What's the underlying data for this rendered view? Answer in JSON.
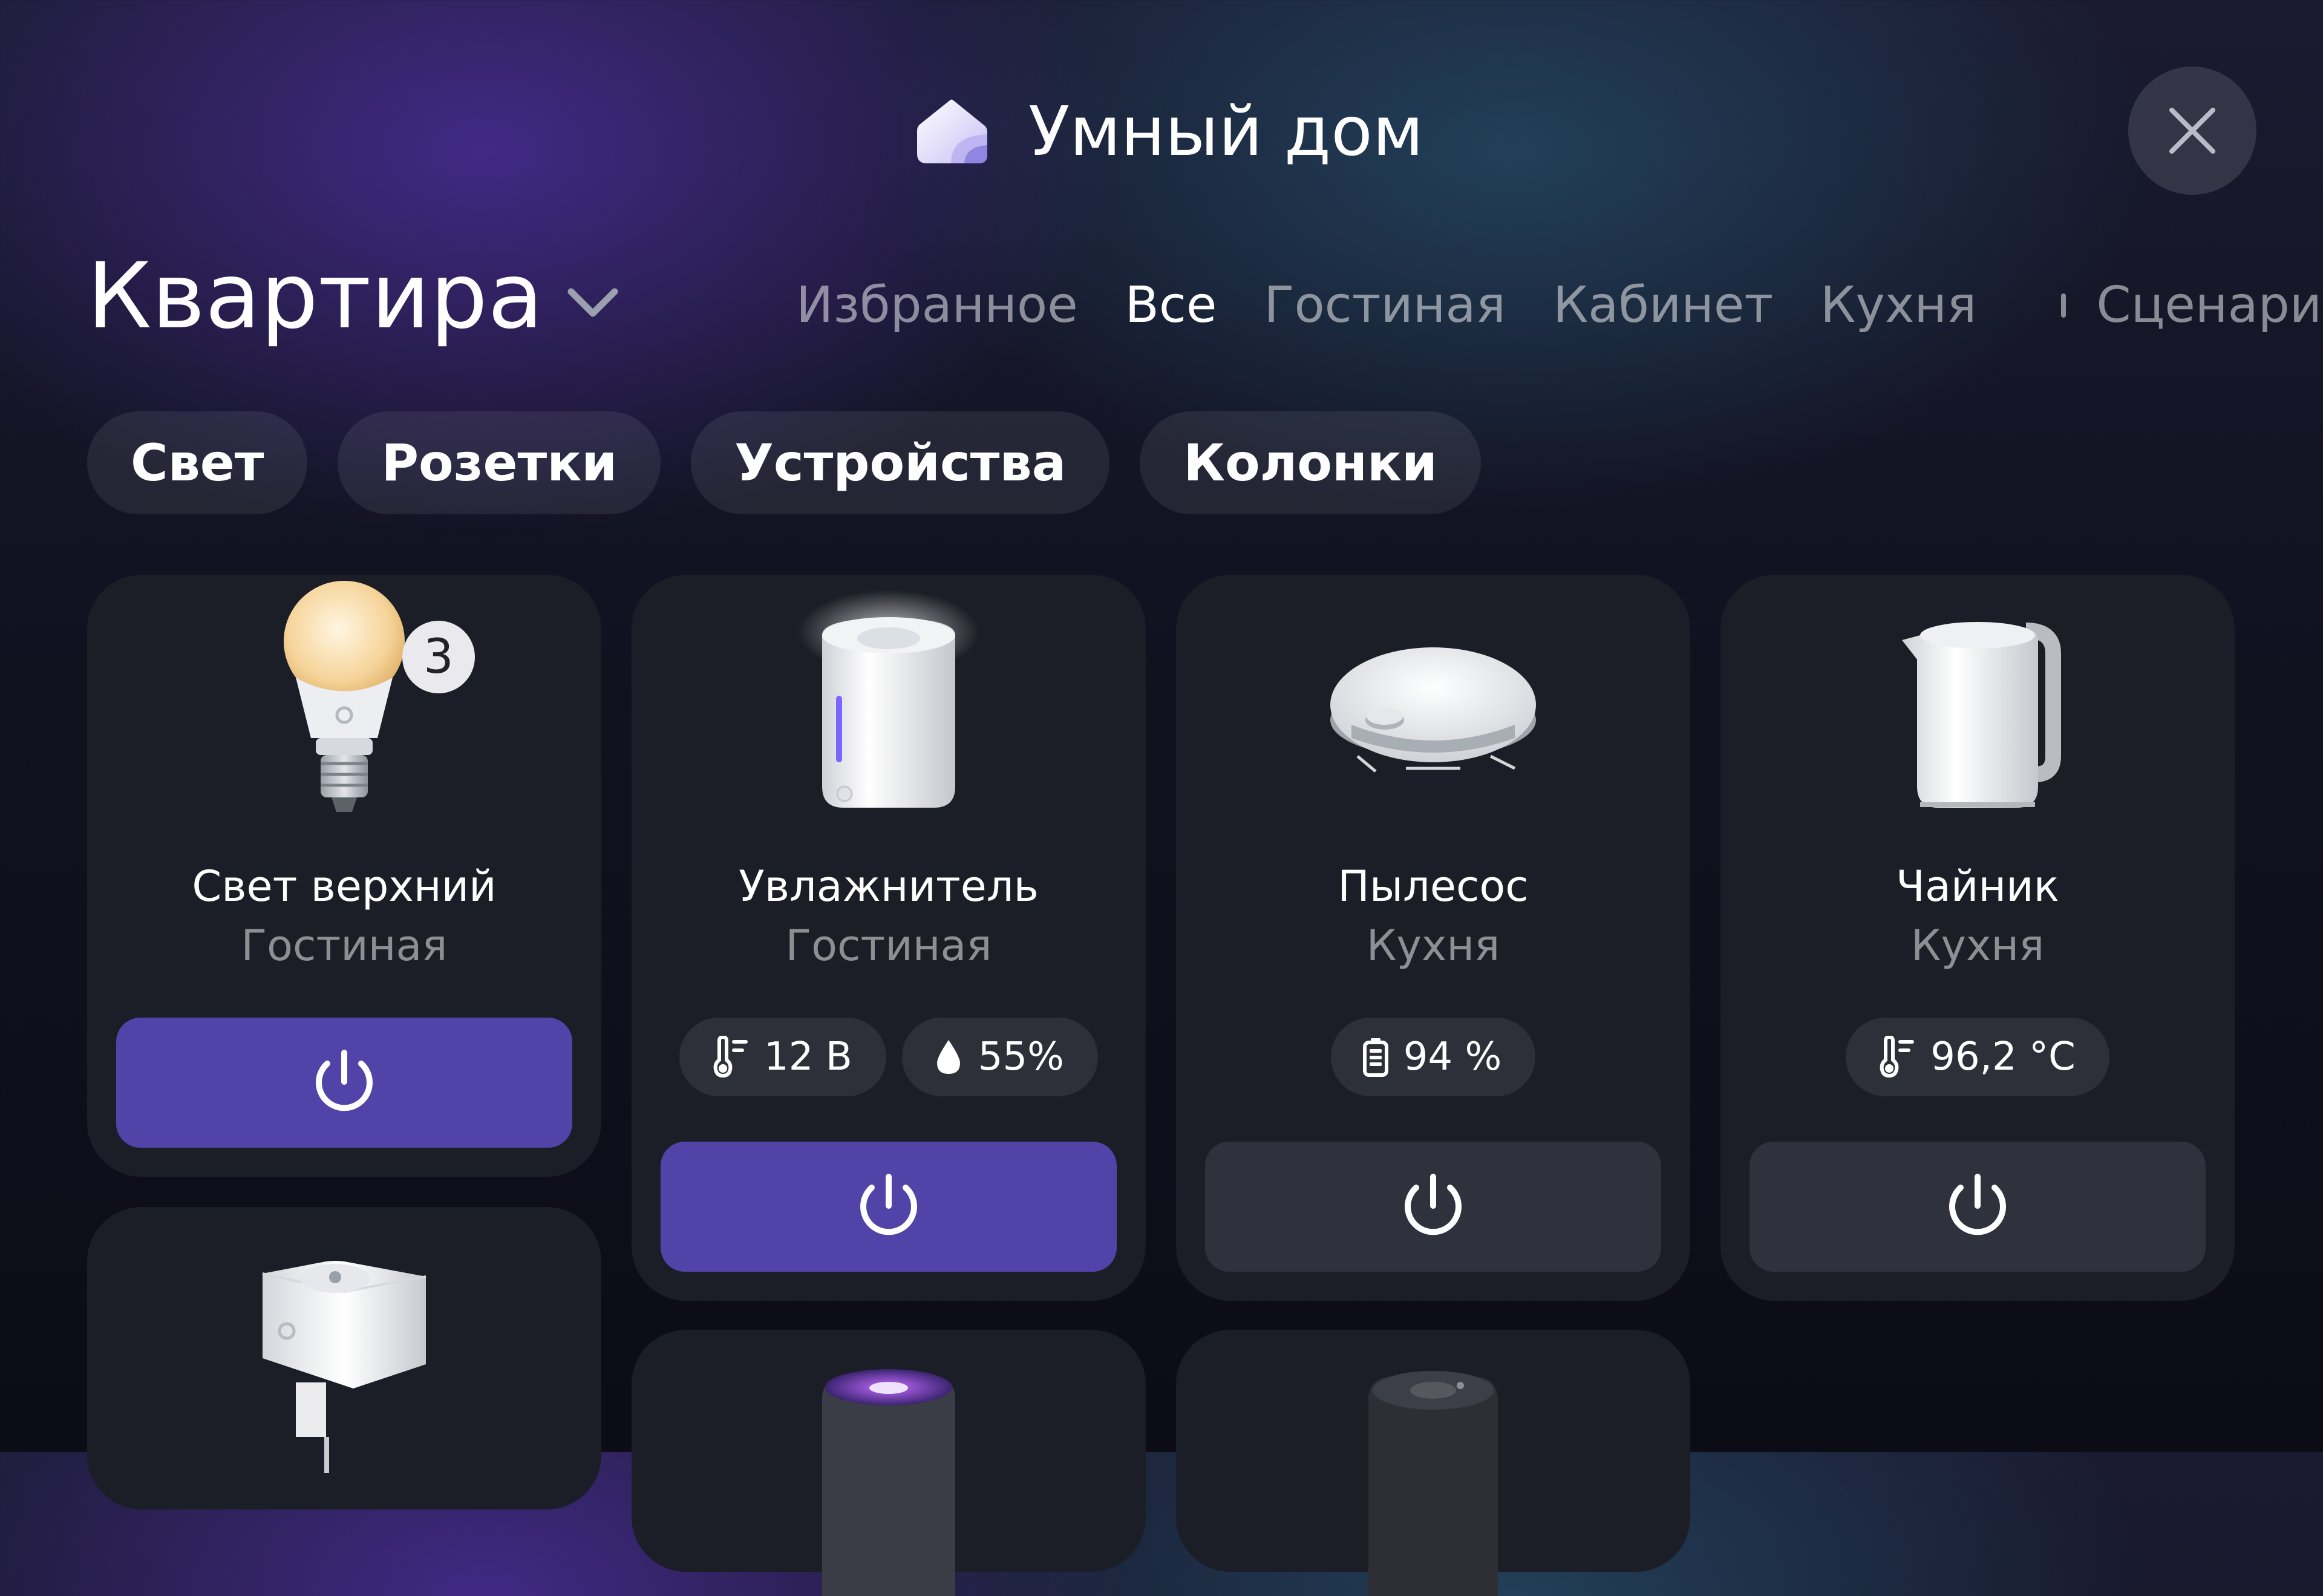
{
  "header": {
    "title": "Умный дом",
    "home_name": "Квартира",
    "logo_icon": "smart-home-house-icon",
    "close_icon": "close-icon"
  },
  "tabs": [
    {
      "label": "Избранное",
      "active": false
    },
    {
      "label": "Все",
      "active": true
    },
    {
      "label": "Гостиная",
      "active": false
    },
    {
      "label": "Кабинет",
      "active": false
    },
    {
      "label": "Кухня",
      "active": false
    },
    {
      "label": "Сценарии",
      "active": false
    }
  ],
  "chips": [
    "Свет",
    "Розетки",
    "Устройства",
    "Колонки"
  ],
  "devices": [
    {
      "name": "Свет верхний",
      "room": "Гостиная",
      "badge": "3",
      "power_on": true,
      "icon": "light-bulb-icon"
    },
    {
      "name": "Увлажнитель",
      "room": "Гостиная",
      "stats": [
        {
          "icon": "thermometer-icon",
          "value": "12 В"
        },
        {
          "icon": "water-drop-icon",
          "value": "55%"
        }
      ],
      "power_on": true,
      "icon": "humidifier-icon"
    },
    {
      "name": "Пылесос",
      "room": "Кухня",
      "stats": [
        {
          "icon": "battery-icon",
          "value": "94 %"
        }
      ],
      "power_on": false,
      "icon": "robot-vacuum-icon"
    },
    {
      "name": "Чайник",
      "room": "Кухня",
      "stats": [
        {
          "icon": "thermometer-icon",
          "value": "96,2 °C"
        }
      ],
      "power_on": false,
      "icon": "kettle-icon"
    },
    {
      "icon": "smart-plug-icon"
    },
    {
      "icon": "smart-speaker-icon"
    },
    {
      "icon": "smart-speaker-mini-icon"
    }
  ],
  "colors": {
    "accent": "#5243a9",
    "card_bg": "#1c1e27",
    "power_off_bg": "#2f323c"
  }
}
